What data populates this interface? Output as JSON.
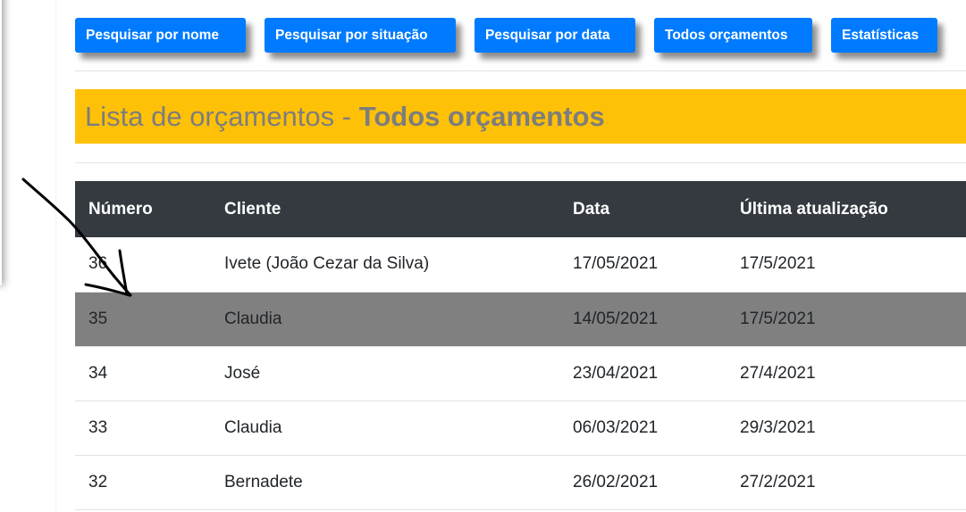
{
  "toolbar": {
    "buttons": [
      {
        "label": "Pesquisar por nome"
      },
      {
        "label": "Pesquisar por situação"
      },
      {
        "label": "Pesquisar por data"
      },
      {
        "label": "Todos orçamentos"
      },
      {
        "label": "Estatísticas"
      }
    ]
  },
  "title": {
    "prefix": "Lista de orçamentos - ",
    "emphasis": "Todos orçamentos"
  },
  "colors": {
    "primary": "#007bff",
    "warning": "#ffc107",
    "header_dark": "#343a40",
    "selected_row": "#808080"
  },
  "table": {
    "headers": [
      "Número",
      "Cliente",
      "Data",
      "Última atualização"
    ],
    "rows": [
      {
        "numero": "36",
        "cliente": "Ivete (João Cezar da Silva)",
        "data": "17/05/2021",
        "atualizacao": "17/5/2021"
      },
      {
        "numero": "35",
        "cliente": "Claudia",
        "data": "14/05/2021",
        "atualizacao": "17/5/2021",
        "selected": true
      },
      {
        "numero": "34",
        "cliente": "José",
        "data": "23/04/2021",
        "atualizacao": "27/4/2021"
      },
      {
        "numero": "33",
        "cliente": "Claudia",
        "data": "06/03/2021",
        "atualizacao": "29/3/2021"
      },
      {
        "numero": "32",
        "cliente": "Bernadete",
        "data": "26/02/2021",
        "atualizacao": "27/2/2021"
      }
    ]
  }
}
